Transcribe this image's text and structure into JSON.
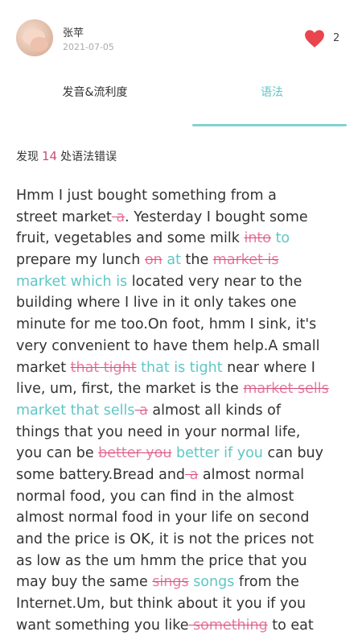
{
  "user": {
    "name": "张苹",
    "date": "2021-07-05"
  },
  "likes": {
    "count": "2",
    "icon": "heart-icon",
    "color": "#e8454f"
  },
  "tabs": [
    {
      "label": "发音&流利度",
      "active": false
    },
    {
      "label": "语法",
      "active": true
    }
  ],
  "summary": {
    "prefix": "发现",
    "count": "14",
    "suffix": "处语法错误"
  },
  "colors": {
    "accent": "#5fc6c6",
    "deleted": "#e87a9f",
    "count": "#c94f77"
  },
  "text_lines": [
    [
      {
        "t": "n",
        "s": "Hmm I just bought something from a"
      }
    ],
    [
      {
        "t": "n",
        "s": "street market"
      },
      {
        "t": "d",
        "s": " a"
      },
      {
        "t": "n",
        "s": ". Yesterday I bought some"
      }
    ],
    [
      {
        "t": "n",
        "s": "fruit, vegetables and some milk "
      },
      {
        "t": "d",
        "s": "into"
      },
      {
        "t": "n",
        "s": " "
      },
      {
        "t": "i",
        "s": "to"
      }
    ],
    [
      {
        "t": "n",
        "s": "prepare my lunch "
      },
      {
        "t": "d",
        "s": "on"
      },
      {
        "t": "n",
        "s": " "
      },
      {
        "t": "i",
        "s": "at"
      },
      {
        "t": "n",
        "s": " the "
      },
      {
        "t": "d",
        "s": "market is"
      }
    ],
    [
      {
        "t": "i",
        "s": "market which is"
      },
      {
        "t": "n",
        "s": " located very near to the"
      }
    ],
    [
      {
        "t": "n",
        "s": "building where I live in it only takes one"
      }
    ],
    [
      {
        "t": "n",
        "s": "minute for me too.On foot, hmm I sink, it's"
      }
    ],
    [
      {
        "t": "n",
        "s": "very convenient to have them help.A small"
      }
    ],
    [
      {
        "t": "n",
        "s": "market "
      },
      {
        "t": "d",
        "s": "that tight"
      },
      {
        "t": "n",
        "s": " "
      },
      {
        "t": "i",
        "s": "that is tight"
      },
      {
        "t": "n",
        "s": " near where I"
      }
    ],
    [
      {
        "t": "n",
        "s": "live, um, first, the market is the "
      },
      {
        "t": "d",
        "s": "market sells"
      }
    ],
    [
      {
        "t": "i",
        "s": "market that sells"
      },
      {
        "t": "d",
        "s": " a"
      },
      {
        "t": "n",
        "s": " almost all kinds of"
      }
    ],
    [
      {
        "t": "n",
        "s": "things that you need in your normal life,"
      }
    ],
    [
      {
        "t": "n",
        "s": "you can be "
      },
      {
        "t": "d",
        "s": "better you"
      },
      {
        "t": "n",
        "s": " "
      },
      {
        "t": "i",
        "s": "better if you"
      },
      {
        "t": "n",
        "s": " can buy"
      }
    ],
    [
      {
        "t": "n",
        "s": "some battery.Bread and"
      },
      {
        "t": "d",
        "s": " a"
      },
      {
        "t": "n",
        "s": " almost normal"
      }
    ],
    [
      {
        "t": "n",
        "s": "normal food, you can find in the almost"
      }
    ],
    [
      {
        "t": "n",
        "s": "almost normal food in your life on second"
      }
    ],
    [
      {
        "t": "n",
        "s": "and the price is OK, it is not the prices not"
      }
    ],
    [
      {
        "t": "n",
        "s": "as low as the um hmm the price that you"
      }
    ],
    [
      {
        "t": "n",
        "s": "may buy the same "
      },
      {
        "t": "d",
        "s": "sings"
      },
      {
        "t": "n",
        "s": " "
      },
      {
        "t": "i",
        "s": "songs"
      },
      {
        "t": "n",
        "s": " from the"
      }
    ],
    [
      {
        "t": "n",
        "s": "Internet.Um, but think about it you if you"
      }
    ],
    [
      {
        "t": "n",
        "s": "want something you like"
      },
      {
        "t": "d",
        "s": " something"
      },
      {
        "t": "n",
        "s": " to eat"
      }
    ]
  ]
}
